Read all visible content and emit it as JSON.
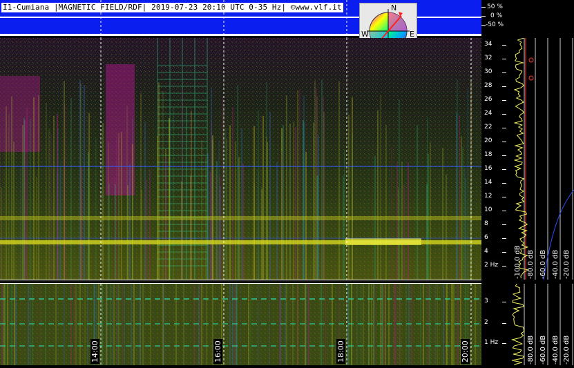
{
  "header": {
    "title": "I1-Cumiana |MAGNETIC FIELD/RDF| 2019-07-23 20:10 UTC 0-35 Hz| ©www.vlf.it",
    "bg_color": "#0a1ef0"
  },
  "compass": {
    "north": "N",
    "south": "S",
    "east": "E",
    "west": "W"
  },
  "percent_scale": [
    "50 %",
    "0 %",
    "-50 %"
  ],
  "freq_scale": {
    "top_labels": [
      "34",
      "32",
      "30",
      "28",
      "26",
      "24",
      "22",
      "20",
      "18",
      "16",
      "14",
      "12",
      "10",
      "8",
      "6",
      "4",
      "2 Hz"
    ],
    "bottom_labels": [
      "3",
      "2",
      "1 Hz"
    ]
  },
  "db_scale": {
    "top_labels": [
      "-100.0 dB",
      "-80.0 dB",
      "-60.0 dB",
      "-40.0 dB",
      "-20.0 dB"
    ],
    "bottom_labels": [
      "-80.0 dB",
      "-60.0 dB",
      "-40.0 dB",
      "-20.0 dB"
    ]
  },
  "time_labels": [
    "14:00",
    "16:00",
    "18:00",
    "20:00"
  ],
  "colors": {
    "background": "#000000",
    "dashed_lines": "#ffffff",
    "spectrum_yellow": "#d8d020",
    "spectrum_green": "#2ea86a",
    "spectrum_magenta": "#c0208c"
  }
}
